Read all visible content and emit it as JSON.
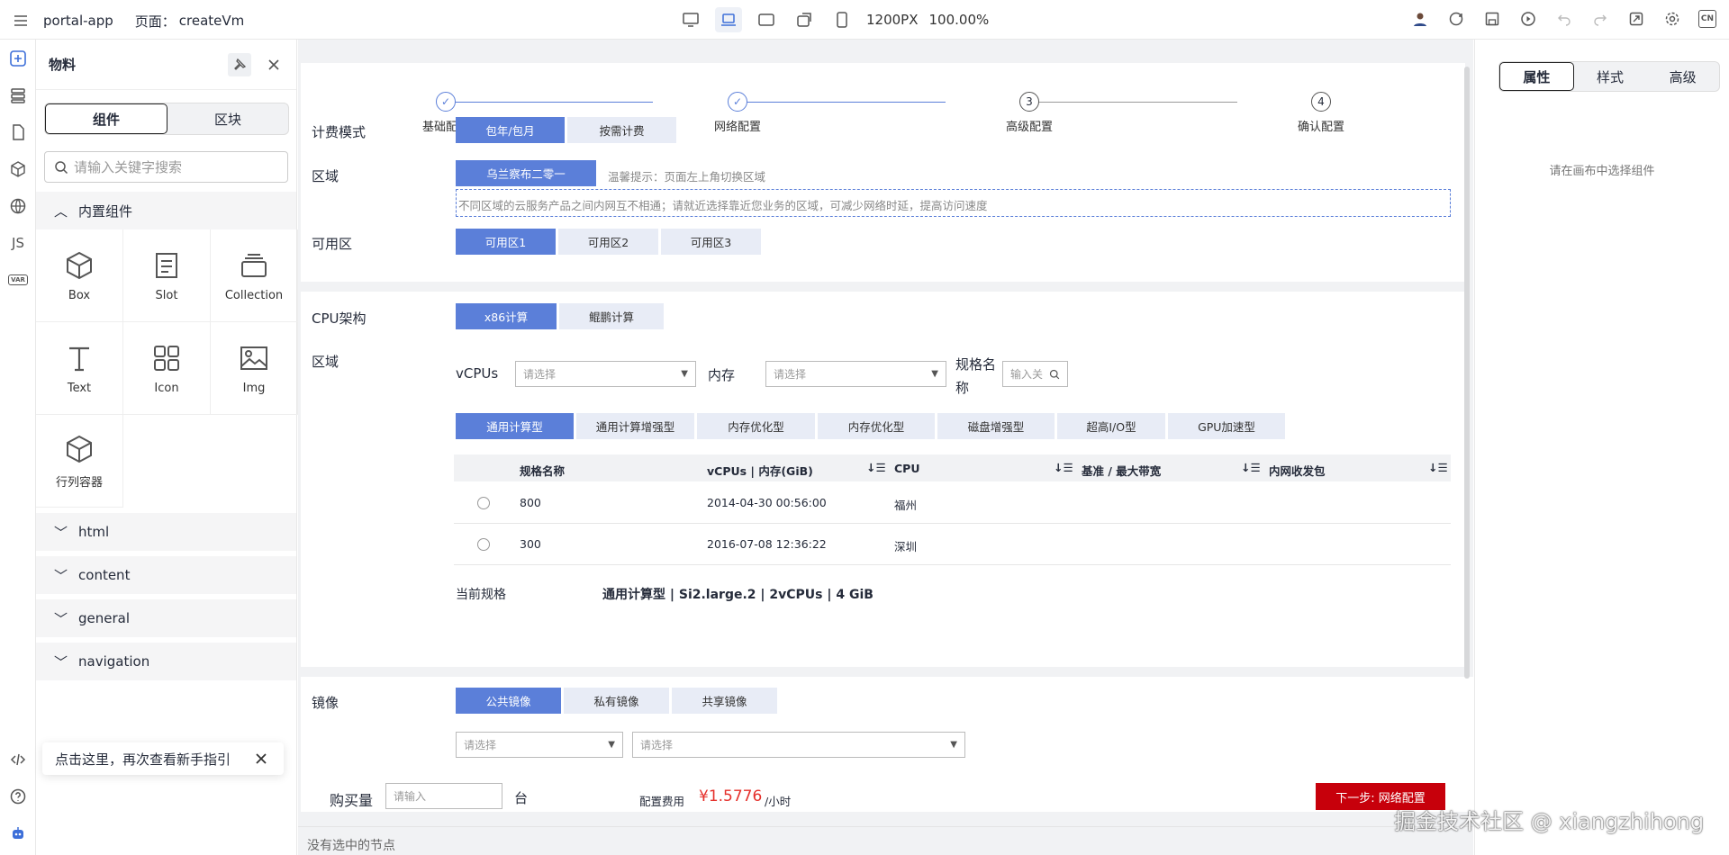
{
  "topbar": {
    "app_name": "portal-app",
    "page_label": "页面：",
    "page_name": "createVm",
    "size_label": "1200PX",
    "zoom_label": "100.00%",
    "lang_label": "CN"
  },
  "activity": {
    "js_label": "JS",
    "var_label": "VAR"
  },
  "panel": {
    "title": "物料",
    "tab_components": "组件",
    "tab_blocks": "区块",
    "search_placeholder": "请输入关键字搜索",
    "builtin_group": "内置组件",
    "components": [
      {
        "label": "Box",
        "icon": "cube-icon"
      },
      {
        "label": "Slot",
        "icon": "slot-icon"
      },
      {
        "label": "Collection",
        "icon": "collection-icon"
      },
      {
        "label": "Text",
        "icon": "text-icon"
      },
      {
        "label": "Icon",
        "icon": "grid-icon"
      },
      {
        "label": "Img",
        "icon": "image-icon"
      },
      {
        "label": "行列容器",
        "icon": "cube-icon"
      }
    ],
    "categories": [
      "html",
      "content",
      "general",
      "navigation"
    ],
    "guide_text": "点击这里，再次查看新手指引"
  },
  "canvas": {
    "steps": [
      {
        "num": "✓",
        "label": "基础配置",
        "done": true
      },
      {
        "num": "✓",
        "label": "网络配置",
        "done": true
      },
      {
        "num": "3",
        "label": "高级配置",
        "done": false
      },
      {
        "num": "4",
        "label": "确认配置",
        "done": false
      }
    ],
    "billing_label": "计费模式",
    "billing_options": [
      "包年/包月",
      "按需计费"
    ],
    "region_label": "区域",
    "region_value": "乌兰察布二零一",
    "region_tip": "温馨提示：页面左上角切换区域",
    "region_note": "不同区域的云服务产品之间内网互不相通；请就近选择靠近您业务的区域，可减少网络时延，提高访问速度",
    "az_label": "可用区",
    "az_options": [
      "可用区1",
      "可用区2",
      "可用区3"
    ],
    "cpu_label": "CPU架构",
    "cpu_options": [
      "x86计算",
      "鲲鹏计算"
    ],
    "region2_label": "区域",
    "vcpus_label": "vCPUs",
    "select_placeholder": "请选择",
    "mem_label": "内存",
    "spec_label": "规格名称",
    "spec_placeholder": "输入关",
    "type_tabs": [
      "通用计算型",
      "通用计算增强型",
      "内存优化型",
      "内存优化型",
      "磁盘增强型",
      "超高I/O型",
      "GPU加速型"
    ],
    "table": {
      "headers": [
        "规格名称",
        "vCPUs | 内存(GiB)",
        "CPU",
        "基准 / 最大带宽",
        "内网收发包"
      ],
      "rows": [
        [
          "800",
          "2014-04-30 00:56:00",
          "福州"
        ],
        [
          "300",
          "2016-07-08 12:36:22",
          "深圳"
        ]
      ]
    },
    "current_spec_label": "当前规格",
    "current_spec_value": "通用计算型 | Si2.large.2 | 2vCPUs | 4 GiB",
    "image_label": "镜像",
    "image_options": [
      "公共镜像",
      "私有镜像",
      "共享镜像"
    ],
    "qty_label": "购买量",
    "qty_placeholder": "请输入",
    "qty_unit": "台",
    "fee_label": "配置费用",
    "fee_value": "¥1.5776",
    "fee_unit": "/小时",
    "next_button": "下一步: 网络配置",
    "status_text": "没有选中的节点"
  },
  "right_panel": {
    "tabs": [
      "属性",
      "样式",
      "高级"
    ],
    "empty_text": "请在画布中选择组件"
  },
  "watermark": "掘金技术社区 @ xiangzhihong",
  "colors": {
    "primary": "#5b7fd9",
    "danger": "#c7000b",
    "fee": "#e5302b"
  }
}
